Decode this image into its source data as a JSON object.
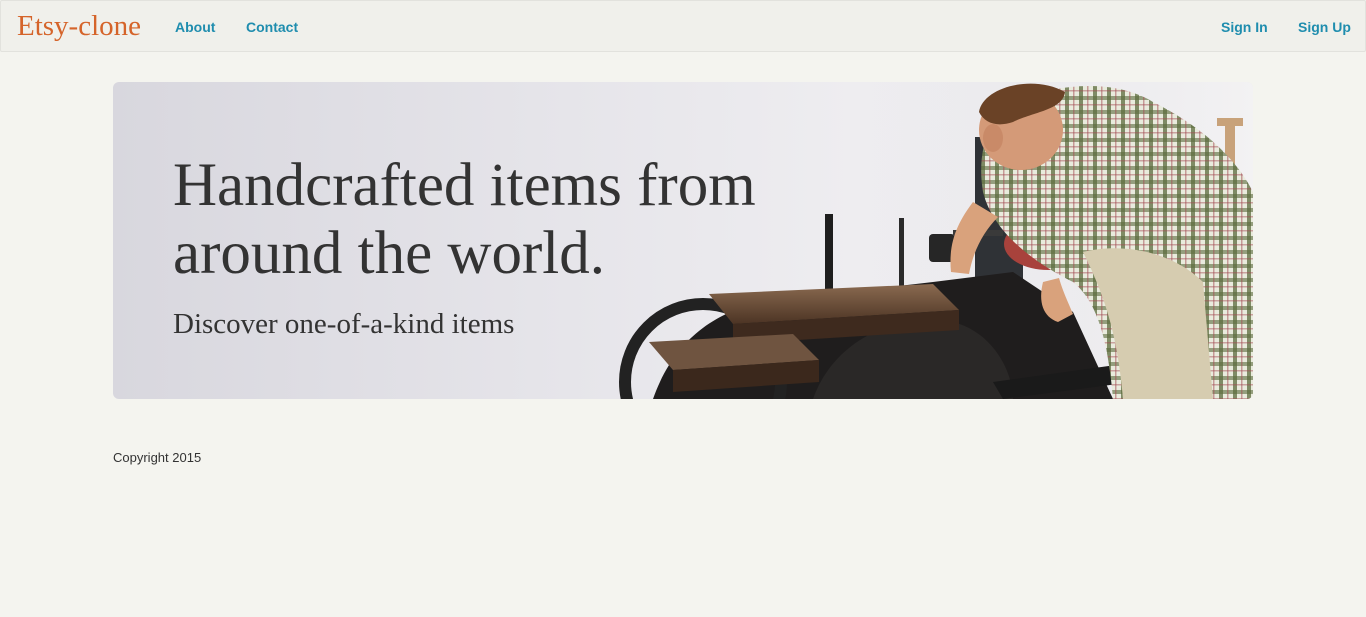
{
  "navbar": {
    "brand": "Etsy-clone",
    "left_links": [
      "About",
      "Contact"
    ],
    "right_links": [
      "Sign In",
      "Sign Up"
    ]
  },
  "hero": {
    "title": "Handcrafted items from around the world.",
    "subtitle": "Discover one-of-a-kind items"
  },
  "footer": {
    "copyright": "Copyright 2015"
  },
  "colors": {
    "brand": "#d5642a",
    "link": "#1f8dae",
    "page_background": "#f4f4ef",
    "navbar_background": "#f0f0eb",
    "text": "#333333"
  }
}
